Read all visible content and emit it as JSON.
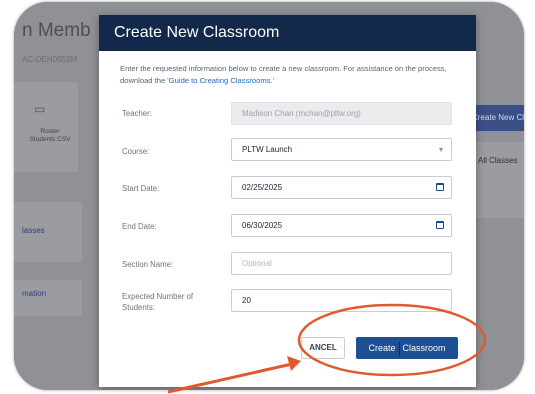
{
  "background": {
    "page_title": "n Memb",
    "code": "AC-DEH0552M",
    "roster_label": "Roster Students CSV",
    "right_button": "Create New Cla",
    "all_classes": "All Classes",
    "left_link_classes": "lasses",
    "left_link_information": "mation"
  },
  "modal": {
    "title": "Create New Classroom",
    "intro_text": "Enter the requested information below to create a new classroom. For assistance on the process, download the ",
    "intro_link": "'Guide to Creating Classrooms.'",
    "fields": {
      "teacher": {
        "label": "Teacher:",
        "value": "Madison Chan (mchan@pltw.org)"
      },
      "course": {
        "label": "Course:",
        "value": "PLTW Launch"
      },
      "start_date": {
        "label": "Start Date:",
        "value": "02/25/2025"
      },
      "end_date": {
        "label": "End Date:",
        "value": "06/30/2025"
      },
      "section_name": {
        "label": "Section Name:",
        "placeholder": "Optional"
      },
      "expected_students": {
        "label": "Expected Number of Students:",
        "value": "20"
      }
    },
    "buttons": {
      "cancel": "ANCEL",
      "create_part1": "Create",
      "create_part2": "Classroom"
    }
  },
  "annotation": {
    "circle_color": "#e05a2b",
    "arrow_color": "#e05a2b"
  }
}
